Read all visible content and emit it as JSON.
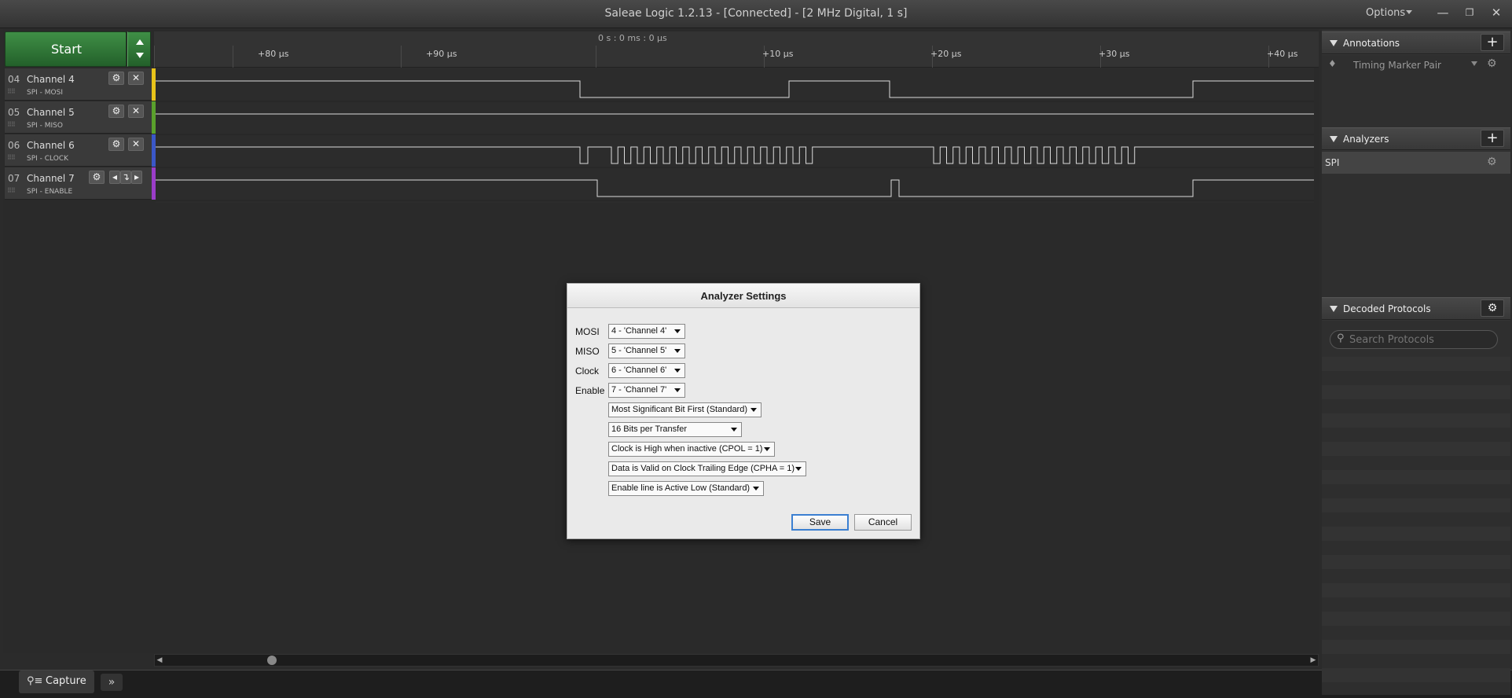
{
  "window": {
    "title": "Saleae Logic 1.2.13 - [Connected] - [2 MHz Digital, 1 s]",
    "options_label": "Options",
    "minimize": "—",
    "restore": "❐",
    "close": "✕"
  },
  "start": {
    "label": "Start"
  },
  "ruler": {
    "center_time": "0 s : 0 ms : 0 μs",
    "ticks": [
      "+80 μs",
      "+90 μs",
      "+10 μs",
      "+20 μs",
      "+30 μs",
      "+40 μs"
    ]
  },
  "channels": [
    {
      "num": "04",
      "name": "Channel 4",
      "sub": "SPI - MOSI",
      "color": "#e8c31a"
    },
    {
      "num": "05",
      "name": "Channel 5",
      "sub": "SPI - MISO",
      "color": "#5aa02c"
    },
    {
      "num": "06",
      "name": "Channel 6",
      "sub": "SPI - CLOCK",
      "color": "#3a57c8"
    },
    {
      "num": "07",
      "name": "Channel 7",
      "sub": "SPI - ENABLE",
      "color": "#9b3dc8"
    }
  ],
  "right": {
    "annotations": "Annotations",
    "timing_marker": "Timing Marker Pair",
    "analyzers": "Analyzers",
    "spi": "SPI",
    "decoded": "Decoded Protocols",
    "search_placeholder": "Search Protocols"
  },
  "bottom": {
    "capture": "Capture",
    "more": "»"
  },
  "dialog": {
    "title": "Analyzer Settings",
    "rows": [
      {
        "label": "MOSI",
        "value": "4 - 'Channel 4'"
      },
      {
        "label": "MISO",
        "value": "5 - 'Channel 5'"
      },
      {
        "label": "Clock",
        "value": "6 - 'Channel 6'"
      },
      {
        "label": "Enable",
        "value": "7 - 'Channel 7'"
      }
    ],
    "options": [
      "Most Significant Bit First (Standard)",
      "16 Bits per Transfer",
      "Clock is High when inactive (CPOL = 1)",
      "Data is Valid on Clock Trailing Edge (CPHA = 1)",
      "Enable line is Active Low (Standard)"
    ],
    "save": "Save",
    "cancel": "Cancel"
  }
}
